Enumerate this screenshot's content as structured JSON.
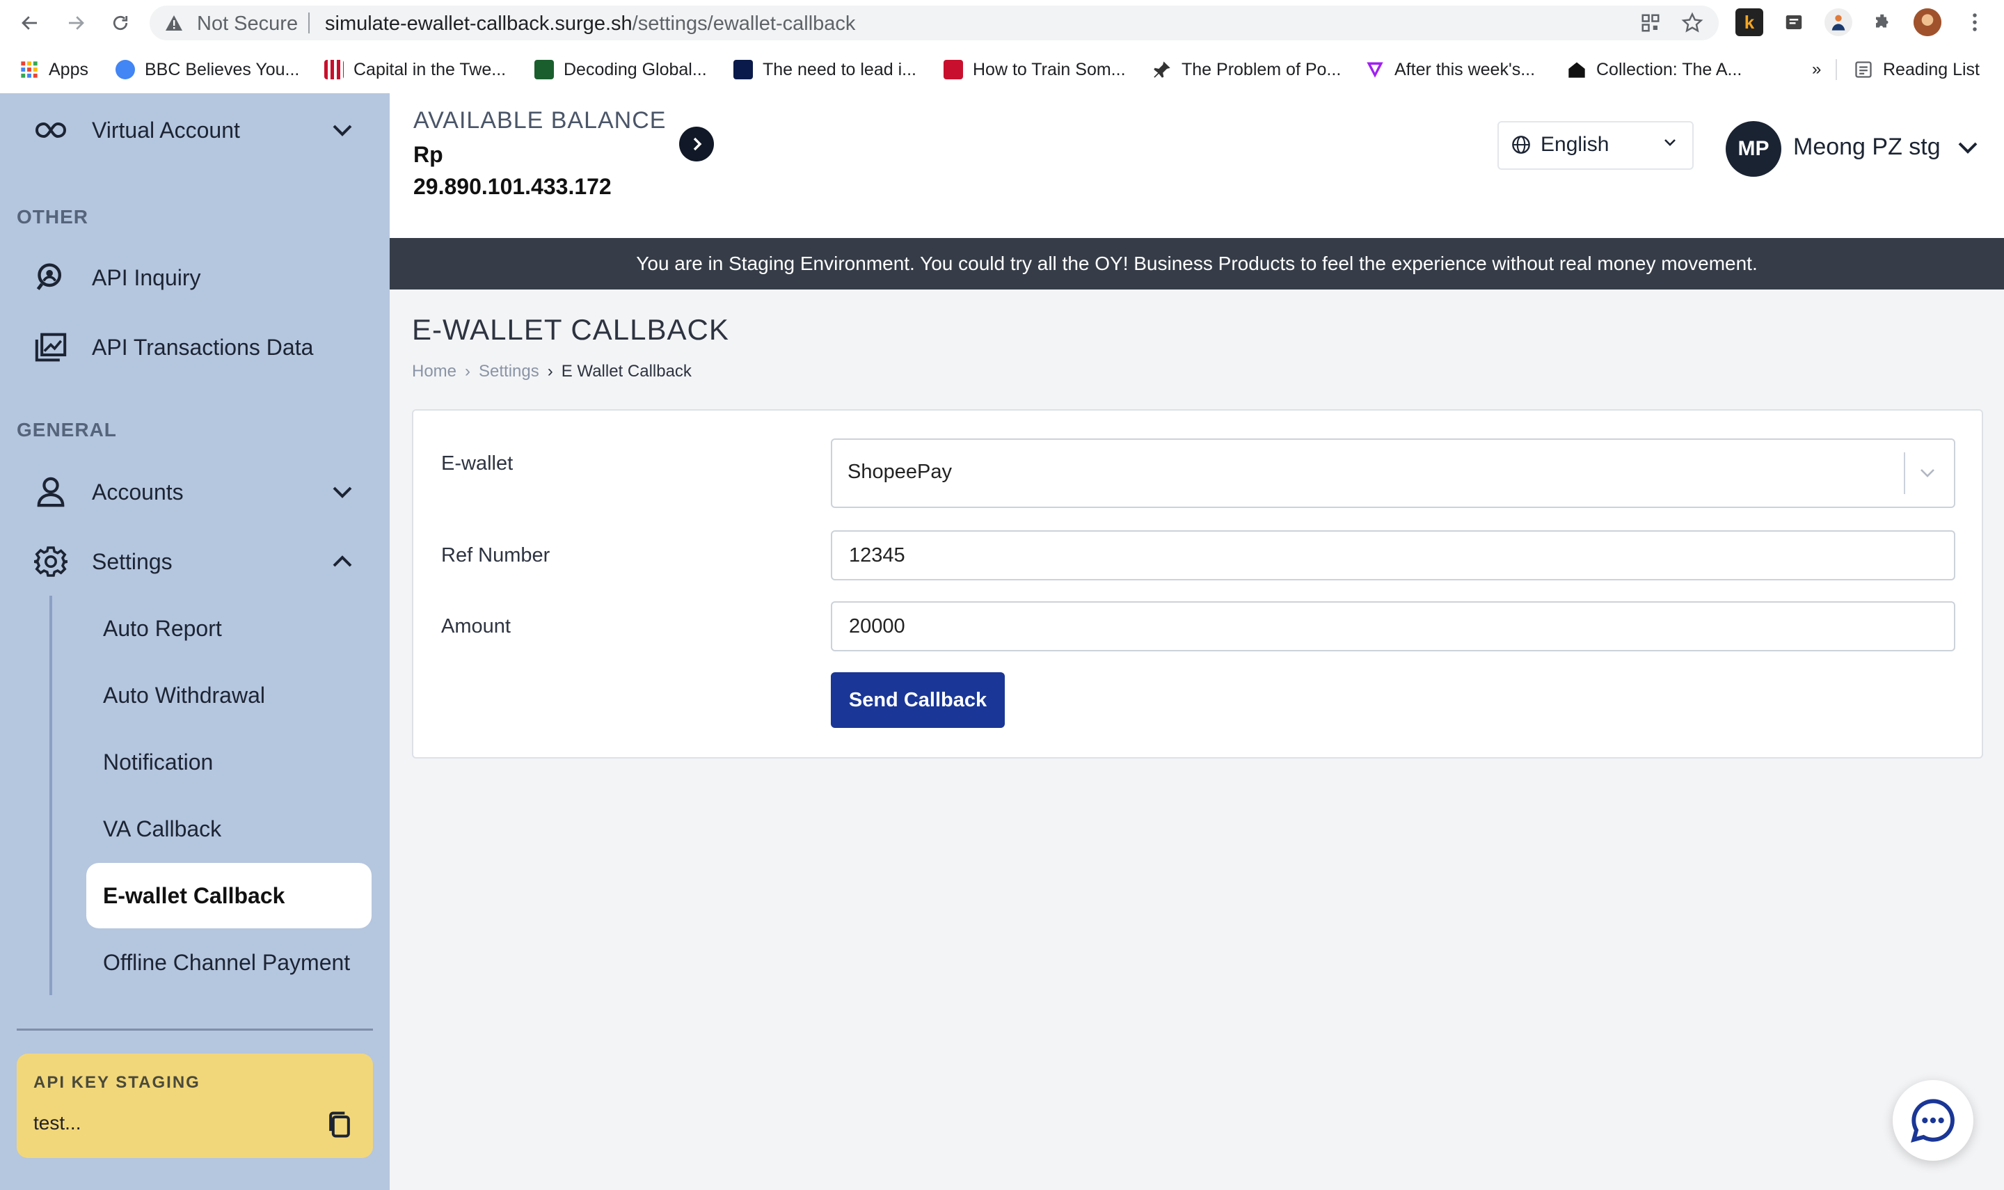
{
  "browser": {
    "security_label": "Not Secure",
    "url_host": "simulate-ewallet-callback.surge.sh",
    "url_path": "/settings/ewallet-callback",
    "bookmarks": [
      {
        "label": "Apps",
        "color": "#ea4335"
      },
      {
        "label": "BBC Believes You...",
        "color": "#4285f4"
      },
      {
        "label": "Capital in the Twe...",
        "color": "#c8102e"
      },
      {
        "label": "Decoding Global...",
        "color": "#1a5e2e"
      },
      {
        "label": "The need to lead i...",
        "color": "#0a1a4a"
      },
      {
        "label": "How to Train Som...",
        "color": "#c8102e"
      },
      {
        "label": "The Problem of Po...",
        "color": "#333333"
      },
      {
        "label": "After this week's...",
        "color": "#a020f0"
      },
      {
        "label": "Collection: The A...",
        "color": "#111111"
      }
    ],
    "overflow_label": "»",
    "reading_list_label": "Reading List"
  },
  "sidebar": {
    "virtual_account_label": "Virtual Account",
    "section_other": "OTHER",
    "api_inquiry_label": "API Inquiry",
    "api_transactions_label": "API Transactions Data",
    "section_general": "GENERAL",
    "accounts_label": "Accounts",
    "settings_label": "Settings",
    "settings_items": [
      {
        "label": "Auto Report"
      },
      {
        "label": "Auto Withdrawal"
      },
      {
        "label": "Notification"
      },
      {
        "label": "VA Callback"
      },
      {
        "label": "E-wallet Callback"
      },
      {
        "label": "Offline Channel Payment"
      }
    ],
    "active_settings_item": "E-wallet Callback",
    "api_key_title": "API KEY STAGING",
    "api_key_value": "test..."
  },
  "header": {
    "balance_label": "AVAILABLE BALANCE",
    "balance_currency": "Rp",
    "balance_amount": "29.890.101.433.172",
    "language": "English",
    "user_initials": "MP",
    "user_name": "Meong PZ stg"
  },
  "banner": {
    "text": "You are in Staging Environment. You could try all the OY! Business Products to feel the experience without real money movement."
  },
  "main": {
    "title": "E-WALLET CALLBACK",
    "breadcrumb": {
      "home": "Home",
      "settings": "Settings",
      "current": "E Wallet Callback",
      "separator": "›"
    },
    "form": {
      "ewallet_label": "E-wallet",
      "ewallet_value": "ShopeePay",
      "ref_label": "Ref Number",
      "ref_value": "12345",
      "amount_label": "Amount",
      "amount_value": "20000",
      "submit_label": "Send Callback"
    }
  },
  "colors": {
    "sidebar_bg": "#b5c6df",
    "primary_button": "#1a3696",
    "banner_bg": "#363d48",
    "api_key_bg": "#f2d77a"
  },
  "icons": {
    "virtual_account": "infinity-icon",
    "api_inquiry": "search-person-icon",
    "api_transactions": "chart-image-icon",
    "accounts": "user-icon",
    "settings": "gear-icon",
    "copy": "copy-icon",
    "chat": "chat-bubble-icon",
    "language": "globe-icon"
  }
}
